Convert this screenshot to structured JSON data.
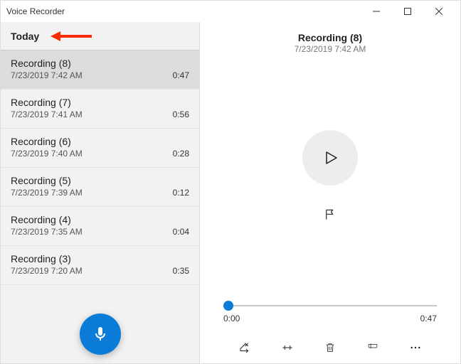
{
  "app": {
    "title": "Voice Recorder"
  },
  "sidebar": {
    "section": "Today",
    "items": [
      {
        "title": "Recording (8)",
        "time": "7/23/2019 7:42 AM",
        "duration": "0:47",
        "selected": true
      },
      {
        "title": "Recording (7)",
        "time": "7/23/2019 7:41 AM",
        "duration": "0:56",
        "selected": false
      },
      {
        "title": "Recording (6)",
        "time": "7/23/2019 7:40 AM",
        "duration": "0:28",
        "selected": false
      },
      {
        "title": "Recording (5)",
        "time": "7/23/2019 7:39 AM",
        "duration": "0:12",
        "selected": false
      },
      {
        "title": "Recording (4)",
        "time": "7/23/2019 7:35 AM",
        "duration": "0:04",
        "selected": false
      },
      {
        "title": "Recording (3)",
        "time": "7/23/2019 7:20 AM",
        "duration": "0:35",
        "selected": false
      }
    ]
  },
  "detail": {
    "title": "Recording (8)",
    "subtitle": "7/23/2019 7:42 AM",
    "pos": "0:00",
    "dur": "0:47"
  },
  "colors": {
    "accent": "#0a7bd6"
  }
}
